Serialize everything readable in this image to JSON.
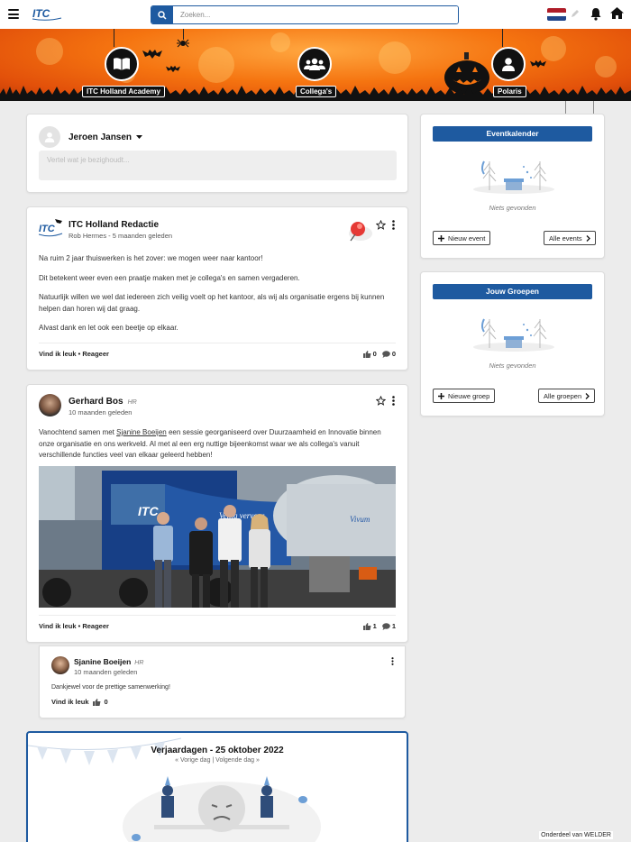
{
  "header": {
    "search_placeholder": "Zoeken...",
    "flag_colors": [
      "#ae1c28",
      "#ffffff",
      "#21468b"
    ],
    "brand_color": "#1e5aa0"
  },
  "banner": {
    "links": [
      {
        "label": "ITC Holland Academy",
        "icon": "book-icon"
      },
      {
        "label": "Collega's",
        "icon": "people-icon"
      },
      {
        "label": "Polaris",
        "icon": "user-icon"
      }
    ]
  },
  "composer": {
    "user_name": "Jeroen Jansen",
    "placeholder": "Vertel wat je bezighoudt..."
  },
  "posts": [
    {
      "author": "ITC Holland Redactie",
      "meta": "Rob Hermes - 5 maanden geleden",
      "paragraphs": [
        "Na ruim 2 jaar thuiswerken is het zover: we mogen weer naar kantoor!",
        "Dit betekent weer even een praatje maken met je collega's en samen vergaderen.",
        "Natuurlijk willen we wel dat iedereen zich veilig voelt op het kantoor, als wij als organisatie ergens bij kunnen helpen dan horen wij dat graag.",
        "Alvast dank en let ook een beetje op elkaar."
      ],
      "actions": "Vind ik leuk • Reageer",
      "likes": "0",
      "comments": "0"
    },
    {
      "author": "Gerhard Bos",
      "role": "HR",
      "meta": "10 maanden geleden",
      "text_before": "Vanochtend samen met ",
      "mention": "Sjanine Boeijen",
      "text_after": "  een sessie georganiseerd over Duurzaamheid en Innovatie binnen onze organisatie en ons werkveld. Al met al een erg nuttige bijeenkomst waar we als collega's vanuit verschillende functies veel van elkaar geleerd hebben!",
      "actions": "Vind ik leuk • Reageer",
      "likes": "1",
      "comments": "1"
    }
  ],
  "comment": {
    "author": "Sjanine Boeijen",
    "role": "HR",
    "meta": "10 maanden geleden",
    "text": "Dankjewel voor de prettige samenwerking!",
    "action": "Vind ik leuk",
    "likes": "0"
  },
  "birthdays": {
    "title": "Verjaardagen - 25 oktober 2022",
    "nav": "« Vorige dag | Volgende dag »"
  },
  "sidebar": {
    "events": {
      "title": "Eventkalender",
      "empty": "Niets gevonden",
      "new_btn": "Nieuw event",
      "all_btn": "Alle events"
    },
    "groups": {
      "title": "Jouw Groepen",
      "empty": "Niets gevonden",
      "new_btn": "Nieuwe groep",
      "all_btn": "Alle groepen"
    }
  },
  "footer_note": "Onderdeel van WELDER"
}
